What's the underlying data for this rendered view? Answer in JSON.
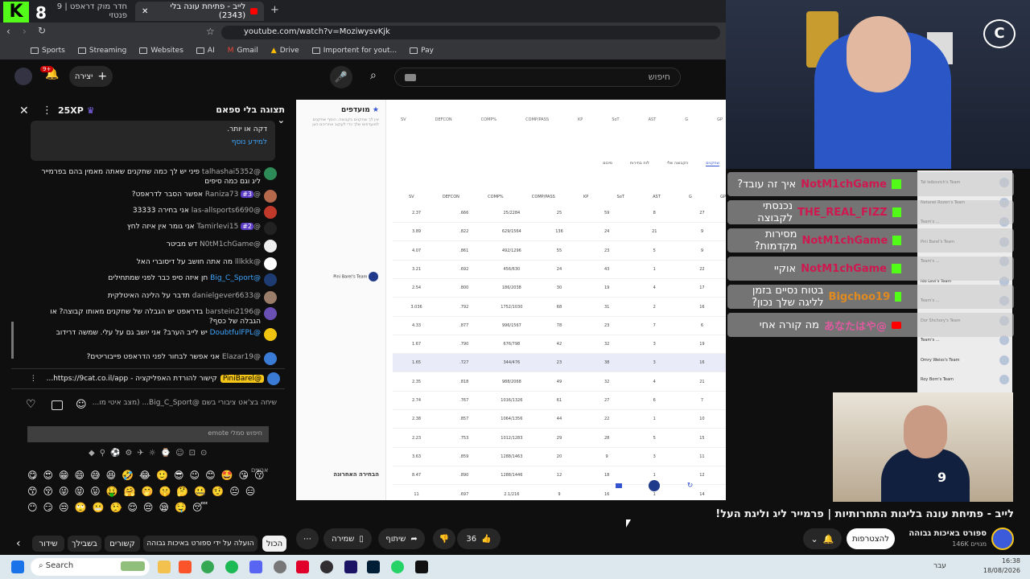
{
  "browser": {
    "tabs": [
      {
        "label": "חדר מוק דראפט | 9 פנטזי"
      },
      {
        "label": "לייב - פתיחת עונה בלי (2343)"
      }
    ],
    "url": "youtube.com/watch?v=MoziwysvKjk",
    "bookmarks": [
      "Sports",
      "Streaming",
      "Websites",
      "AI",
      "Gmail",
      "Drive",
      "Importent for yout...",
      "Pay"
    ]
  },
  "yt": {
    "search_placeholder": "חיפוש",
    "create_label": "יצירה",
    "notif_count": "9+"
  },
  "chat": {
    "header_label": "תצוגה בלי ספאם",
    "xp": "25XP",
    "top_text": "דקה או יותר.",
    "learn_more": "למידע נוסף",
    "messages": [
      {
        "name": "@talhashai5352",
        "text": "פיני יש לך כמה שחקנים שאתה מאמין בהם בפרמייר ליג וגם כמה סיפים"
      },
      {
        "name": "@Raniza73",
        "text": "אפשר הסבר לדראפט?",
        "badge": "#3"
      },
      {
        "name": "@las-allsports6690",
        "text": "אני בחירה 33333"
      },
      {
        "name": "@Tamirlevi15",
        "text": "אני גומר אין איזה לחץ",
        "badge": "#2"
      },
      {
        "name": "@N0tM1chGame",
        "text": "דש מביטר"
      },
      {
        "name": "@lllkkk",
        "text": "מה אתה חושב על דיסוברי האל"
      },
      {
        "name": "@Big_C_Sport",
        "text": "חן איזה סיפ כבר לפני שמתחילים"
      },
      {
        "name": "@danielgever6633",
        "text": "תדבר על הלינה האיטלקית"
      },
      {
        "name": "@barstein2196",
        "text": "בדראפט יש הגבלה של שחקנים מאותו קבוצה? או הגבלה של כסף?"
      },
      {
        "name": "@DoubtfulFPL",
        "text": "יש לייב הערב? אני יושב גם על עלי. שמשה דרידוב"
      },
      {
        "name": "@Elazar19",
        "text": "אני אפשר לבחור לפני הדראפט פייבוריטים?"
      }
    ],
    "pinned": {
      "name": "@PiniBarel",
      "text": "קישור להורדת האפליקציה - https://9cat.co.il/app..."
    },
    "input_placeholder": "שיחה בצ'אט ציבורי בשם @Big_C_Sport... (מצב איטי מו...",
    "emoji_search": "חיפוש סמלי emote",
    "emoji_section": "אנשים",
    "emojis": [
      "😋",
      "😍",
      "😁",
      "😄",
      "😅",
      "😆",
      "🤣",
      "😂",
      "🙂",
      "😎",
      "😉",
      "😊",
      "🤩",
      "😘",
      "😗",
      "😙",
      "😚",
      "😜",
      "😝",
      "😛",
      "🤑",
      "🤗",
      "🤭",
      "🤫",
      "🤔",
      "🤐",
      "🤨",
      "😐",
      "😑",
      "😶",
      "😏",
      "😒",
      "🙄",
      "😬",
      "🤥",
      "😌",
      "😔",
      "😪",
      "🤤",
      "😴"
    ]
  },
  "video": {
    "sidebar_title": "מועדפים",
    "sidebar_sub": "אין לך שחקנים בקבוצה. הוסף שחקנים למועדפים שלך כדי לעקוב אחריהם כאן",
    "headers": [
      "SV",
      "DEFCON",
      "COMP%",
      "COMP/PASS",
      "KP",
      "SoT",
      "AST",
      "G",
      "GP"
    ],
    "tabs": [
      "שחקנים",
      "הקבוצה שלי",
      "לוח בחירות",
      "סיכום"
    ],
    "team_header": "Pini Barel's Team",
    "last_pick": "הבחירה האחרונה",
    "rows": [
      [
        "2.37",
        ".666",
        "25/2284",
        "25",
        "59",
        "8",
        "27"
      ],
      [
        "3.89",
        ".822",
        "629/1564",
        "136",
        "24",
        "21",
        "9"
      ],
      [
        "4.07",
        ".861",
        "492/1296",
        "55",
        "23",
        "5",
        "9"
      ],
      [
        "3.21",
        ".692",
        "456/630",
        "24",
        "43",
        "1",
        "22"
      ],
      [
        "2.54",
        ".800",
        "186/2038",
        "30",
        "19",
        "4",
        "17"
      ],
      [
        "3.036",
        ".792",
        "1752/1030",
        "68",
        "31",
        "2",
        "16"
      ],
      [
        "4.33",
        ".877",
        "996/1567",
        "78",
        "23",
        "7",
        "6"
      ],
      [
        "1.67",
        ".790",
        "676/798",
        "42",
        "32",
        "3",
        "19"
      ],
      [
        "1.65",
        ".727",
        "344/476",
        "23",
        "38",
        "3",
        "16"
      ],
      [
        "2.35",
        ".818",
        "988/2068",
        "49",
        "32",
        "4",
        "21"
      ],
      [
        "2.74",
        ".767",
        "1016/1326",
        "61",
        "27",
        "6",
        "7"
      ],
      [
        "2.38",
        ".857",
        "1064/1356",
        "44",
        "22",
        "1",
        "10"
      ],
      [
        "2.23",
        ".753",
        "1012/1283",
        "29",
        "28",
        "5",
        "15"
      ],
      [
        "3.63",
        ".859",
        "1288/1463",
        "20",
        "9",
        "3",
        "11"
      ],
      [
        "8.47",
        ".890",
        "1288/1446",
        "12",
        "18",
        "1",
        "12"
      ],
      [
        "11",
        ".697",
        "2.1/216",
        "9",
        "16",
        "1",
        "14"
      ]
    ]
  },
  "overlay": {
    "messages": [
      {
        "user": "NotM1chGame",
        "text": "איך זה עובד?"
      },
      {
        "user": "THE_REAL_FIZZ",
        "text": "נכנסתי לקבוצה"
      },
      {
        "user": "NotM1chGame",
        "text": "מסירות מקדמות?"
      },
      {
        "user": "NotM1chGame",
        "text": "אוקיי"
      },
      {
        "user": "Bigchoo19",
        "text": "בטוח נסיים בזמן לליגה שלך נכון?"
      },
      {
        "user": "@あなたはや",
        "text": "מה קורה אחי"
      }
    ],
    "teams": [
      "Tal leibovich's Team",
      "Netanel Rozen's Team",
      "Team's ...",
      "Pini Barel's Team",
      "Team's ...",
      "Ido Levi's Team",
      "Team's ...",
      "Dor Shchory's Team",
      "Team's ...",
      "Omry Weiss's Team",
      "Roy Bom's Team"
    ]
  },
  "page": {
    "title": "לייב - פתיחת עונה בליגות התחרותיות | פרמייר ליג וליגת העל!",
    "channel": "ספורט באיכות גבוהה",
    "subs": "146K מנויים",
    "join": "להצטרפות",
    "likes": "36",
    "share": "שיתוף",
    "save": "שמירה",
    "chips": [
      "הכול",
      "הועלה על ידי ספורט באיכות גבוהה",
      "קשורים",
      "בשבילך",
      "שידור"
    ]
  },
  "taskbar": {
    "search": "Search",
    "lang": "עבר",
    "time": "16:38",
    "date": "18/08/2026"
  },
  "colors": {
    "accent": "#ff0000",
    "kick": "#53fc18",
    "overlay_user": "#d01850"
  }
}
